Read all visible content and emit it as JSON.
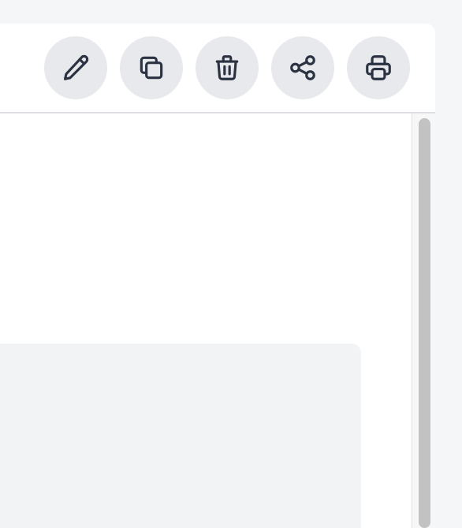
{
  "toolbar": {
    "buttons": [
      {
        "icon": "pencil-icon",
        "action": "edit"
      },
      {
        "icon": "copy-icon",
        "action": "duplicate"
      },
      {
        "icon": "trash-icon",
        "action": "delete"
      },
      {
        "icon": "share-icon",
        "action": "share"
      },
      {
        "icon": "printer-icon",
        "action": "print"
      }
    ]
  },
  "colors": {
    "page_background": "#f5f6f8",
    "window_background": "#ffffff",
    "button_background": "#e8e9ec",
    "icon_color": "#2b3342",
    "panel_background": "#f2f3f5",
    "scrollbar_thumb": "#c2c2c2"
  }
}
